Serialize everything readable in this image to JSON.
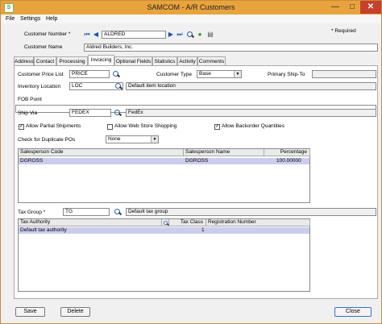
{
  "window": {
    "title": "SAMCOM - A/R Customers",
    "app_icon": "S"
  },
  "menu": {
    "file": "File",
    "settings": "Settings",
    "help": "Help"
  },
  "header": {
    "customer_number_label": "Customer Number *",
    "customer_number_value": "ALDRED",
    "customer_name_label": "Customer Name",
    "customer_name_value": "Aldred Builders, Inc.",
    "required_note": "* Required"
  },
  "tabs": [
    "Address",
    "Contact",
    "Processing",
    "Invoicing",
    "Optional Fields",
    "Statistics",
    "Activity",
    "Comments"
  ],
  "active_tab": "Invoicing",
  "invoicing": {
    "price_list_label": "Customer Price List",
    "price_list_value": "PRICE",
    "customer_type_label": "Customer Type",
    "customer_type_value": "Base",
    "primary_ship_to_label": "Primary Ship-To",
    "primary_ship_to_value": "",
    "inventory_location_label": "Inventory Location",
    "inventory_location_value": "LOC",
    "inventory_location_desc": "Default item location",
    "fob_label": "FOB Point",
    "fob_value": "",
    "ship_via_label": "Ship Via",
    "ship_via_value": "FEDEX",
    "ship_via_desc": "FedEx",
    "allow_partial_label": "Allow Partial Shipments",
    "allow_partial": true,
    "allow_web_label": "Allow Web Store Shopping",
    "allow_web": false,
    "allow_backorder_label": "Allow Backorder Quantities",
    "allow_backorder": true,
    "check_dup_label": "Check for Duplicate POs",
    "check_dup_value": "None"
  },
  "salesperson_grid": {
    "headers": [
      "Salesperson Code",
      "Salesperson Name",
      "Percentage"
    ],
    "rows": [
      [
        "DGROSS",
        "DGROSS",
        "100.00000"
      ]
    ]
  },
  "tax": {
    "tax_group_label": "Tax Group *",
    "tax_group_value": "TG",
    "tax_group_desc": "Default tax group",
    "headers": [
      "Tax Authority",
      "Tax Class",
      "Registration Number"
    ],
    "rows": [
      [
        "Default tax authority",
        "1",
        ""
      ]
    ]
  },
  "buttons": {
    "save": "Save",
    "delete": "Delete",
    "close": "Close"
  },
  "colors": {
    "titlebar": "#e8a33d",
    "selected_row": "#ccccee",
    "close_button": "#c7402d"
  }
}
